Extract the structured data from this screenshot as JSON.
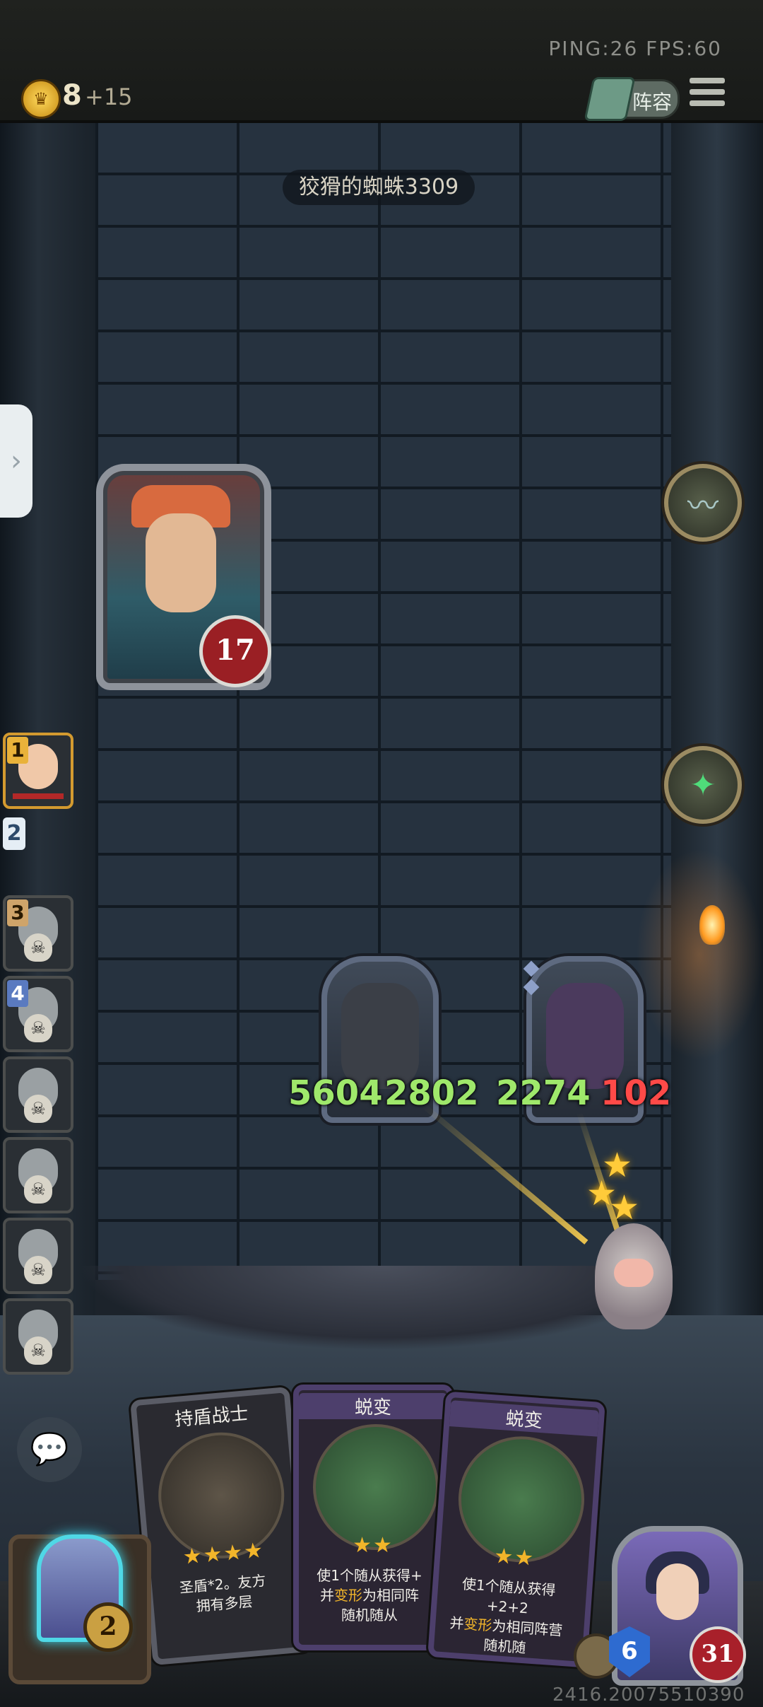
{
  "top_bar": {
    "ping_fps": "PING:26   FPS:60",
    "gold": "8",
    "gold_income": "+15",
    "lineup_label": "阵容",
    "menu_icon": "hamburger-menu-icon"
  },
  "opponent": {
    "name": "狡猾的蜘蛛3309",
    "health": "17"
  },
  "powers": {
    "power1_icon": "horn-icon",
    "power2_icon": "frog-icon"
  },
  "roster": [
    {
      "rank": "1"
    },
    {
      "rank": "2"
    },
    {
      "rank": "3"
    },
    {
      "rank": "4"
    },
    {
      "rank": ""
    },
    {
      "rank": ""
    },
    {
      "rank": ""
    },
    {
      "rank": ""
    }
  ],
  "board": {
    "minion1": {
      "attack": "5604",
      "health": "2802"
    },
    "minion2": {
      "attack": "2274",
      "health": "102"
    }
  },
  "hand": [
    {
      "title": "持盾战士",
      "stars": "★★★★",
      "desc_line1": "圣盾*2。友方",
      "desc_line2": "拥有多层"
    },
    {
      "title": "蜕变",
      "stars": "★★",
      "desc_line1": "使1个随从获得+",
      "desc_line2a": "并",
      "desc_kw": "变形",
      "desc_line2b": "为相同阵",
      "desc_line3": "随机随从"
    },
    {
      "title": "蜕变",
      "stars": "★★",
      "desc_line1": "使1个随从获得+2+2",
      "desc_line2a": "并",
      "desc_kw": "变形",
      "desc_line2b": "为相同阵营",
      "desc_line3": "随机随"
    }
  ],
  "player": {
    "tavern_tier": "2",
    "armor": "6",
    "health": "31"
  },
  "footer": {
    "build": "2416.20075510390"
  },
  "colors": {
    "attack": "#9fe86b",
    "damaged_health": "#ff4a48",
    "gold": "#f2b52a"
  }
}
